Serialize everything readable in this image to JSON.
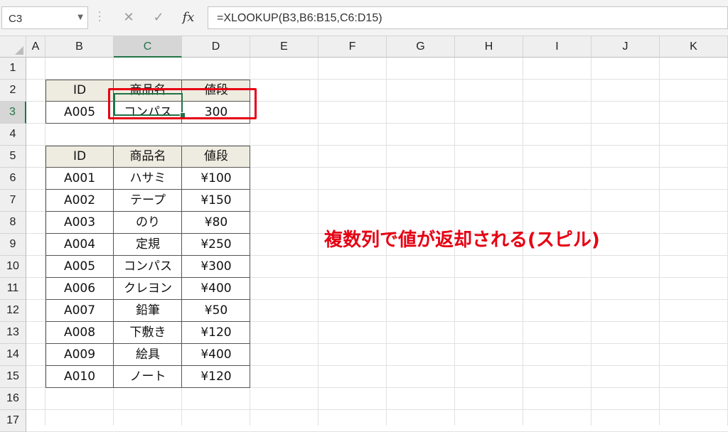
{
  "namebox": {
    "cell": "C3"
  },
  "formula_bar": {
    "formula": "=XLOOKUP(B3,B6:B15,C6:D15)"
  },
  "columns": [
    "A",
    "B",
    "C",
    "D",
    "E",
    "F",
    "G",
    "H",
    "I",
    "J",
    "K"
  ],
  "rows": [
    "1",
    "2",
    "3",
    "4",
    "5",
    "6",
    "7",
    "8",
    "9",
    "10",
    "11",
    "12",
    "13",
    "14",
    "15",
    "16",
    "17"
  ],
  "selected_cell": {
    "column": "C",
    "row": "3"
  },
  "lookup_table": {
    "headers": [
      "ID",
      "商品名",
      "値段"
    ],
    "row": [
      "A005",
      "コンパス",
      "300"
    ]
  },
  "data_table": {
    "headers": [
      "ID",
      "商品名",
      "値段"
    ],
    "rows": [
      [
        "A001",
        "ハサミ",
        "¥100"
      ],
      [
        "A002",
        "テープ",
        "¥150"
      ],
      [
        "A003",
        "のり",
        "¥80"
      ],
      [
        "A004",
        "定規",
        "¥250"
      ],
      [
        "A005",
        "コンパス",
        "¥300"
      ],
      [
        "A006",
        "クレヨン",
        "¥400"
      ],
      [
        "A007",
        "鉛筆",
        "¥50"
      ],
      [
        "A008",
        "下敷き",
        "¥120"
      ],
      [
        "A009",
        "絵具",
        "¥400"
      ],
      [
        "A010",
        "ノート",
        "¥120"
      ]
    ]
  },
  "annotation": "複数列で値が返却される(スピル)",
  "colors": {
    "accent": "#217346",
    "highlight": "#e60012",
    "header_fill": "#eeebe0"
  }
}
